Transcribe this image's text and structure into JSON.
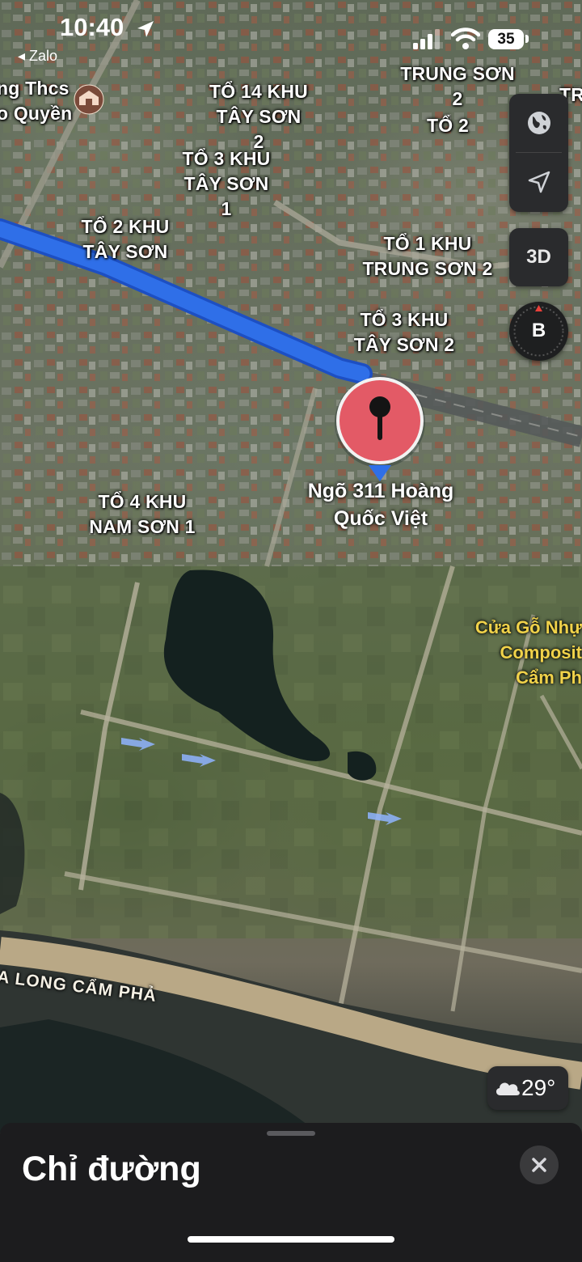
{
  "status_bar": {
    "time": "10:40",
    "back_app": "◂ Zalo",
    "battery": "35"
  },
  "map": {
    "labels": [
      {
        "id": "to14",
        "text": "TỔ 14 KHU\nTÂY SƠN 2"
      },
      {
        "id": "to3ts1",
        "text": "TỔ 3 KHU\nTÂY SƠN 1"
      },
      {
        "id": "to2ts",
        "text": "TỔ 2 KHU\nTÂY SƠN"
      },
      {
        "id": "to1ts2",
        "text": "TỔ 1 KHU\nTRUNG SƠN 2"
      },
      {
        "id": "to3ts2",
        "text": "TỔ 3 KHU\nTÂY SƠN 2"
      },
      {
        "id": "to4ns1",
        "text": "TỔ 4 KHU\nNAM SƠN 1"
      },
      {
        "id": "trungson2",
        "text": "TRUNG SƠN 2"
      },
      {
        "id": "to2",
        "text": "TỔ 2"
      },
      {
        "id": "tr_edge",
        "text": "TR"
      }
    ],
    "school_label": "ng Thcs\no Quyền",
    "poi_label": "Cửa Gỗ Nhự\nComposit\nCẩm Ph",
    "pin_label": "Ngõ 311 Hoàng\nQuốc Việt",
    "road_label": "A LONG CẨM PHẢ",
    "route_color": "#2f6fe8",
    "pin_color": "#e35a66"
  },
  "controls": {
    "globe_icon": "globe-icon",
    "location_icon": "location-arrow-icon",
    "view_3d": "3D",
    "compass_letter": "B",
    "weather_temp": "29°"
  },
  "sheet": {
    "title": "Chỉ đường"
  }
}
